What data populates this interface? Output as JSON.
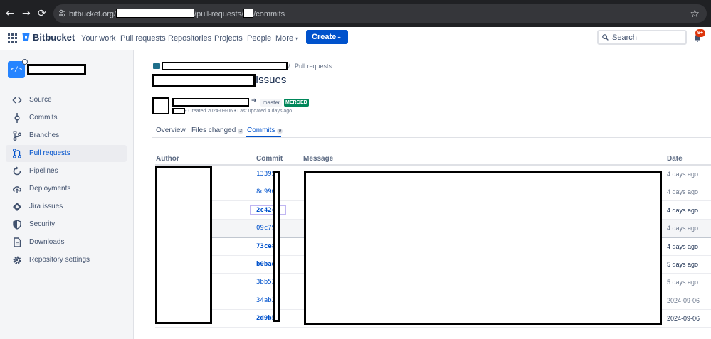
{
  "browser": {
    "url_host": "bitbucket.org/",
    "url_mid": "/pull-requests/",
    "url_tail": "/commits",
    "back_glyph": "←",
    "forward_glyph": "→",
    "reload_glyph": "⟳",
    "star_glyph": "☆"
  },
  "topnav": {
    "brand": "Bitbucket",
    "items": [
      "Your work",
      "Pull requests",
      "Repositories",
      "Projects",
      "People",
      "More"
    ],
    "more_chevron": "▾",
    "create_label": "Create",
    "create_chevron": "⌄",
    "search_placeholder": "Search",
    "notification_count": "9+",
    "accent": "#0052cc"
  },
  "sidebar": {
    "repo_avatar_glyph": "</>",
    "items": [
      {
        "label": "Source",
        "icon": "code-icon",
        "active": false
      },
      {
        "label": "Commits",
        "icon": "commit-icon",
        "active": false
      },
      {
        "label": "Branches",
        "icon": "branch-icon",
        "active": false
      },
      {
        "label": "Pull requests",
        "icon": "pull-request-icon",
        "active": true
      },
      {
        "label": "Pipelines",
        "icon": "pipelines-icon",
        "active": false
      },
      {
        "label": "Deployments",
        "icon": "cloud-upload-icon",
        "active": false
      },
      {
        "label": "Jira issues",
        "icon": "jira-icon",
        "active": false
      },
      {
        "label": "Security",
        "icon": "shield-icon",
        "active": false
      },
      {
        "label": "Downloads",
        "icon": "document-icon",
        "active": false
      },
      {
        "label": "Repository settings",
        "icon": "gear-icon",
        "active": false
      }
    ]
  },
  "main": {
    "breadcrumb_sep": "/",
    "breadcrumb_pr": "Pull requests",
    "title_suffix": "Issues",
    "destination_branch": "master",
    "arrow": "➔",
    "status": "MERGED",
    "meta": "• Created 2024-09-06 • Last updated 4 days ago",
    "tabs": [
      {
        "label": "Overview",
        "count": ""
      },
      {
        "label": "Files changed",
        "count": "2"
      },
      {
        "label": "Commits",
        "count": "9"
      }
    ],
    "columns": {
      "author": "Author",
      "commit": "Commit",
      "message": "Message",
      "date": "Date"
    },
    "commits": [
      {
        "hash": "13395",
        "date": "4 days ago",
        "emphasis": false
      },
      {
        "hash": "8c990",
        "date": "4 days ago",
        "emphasis": false
      },
      {
        "hash": "2c42c",
        "date": "4 days ago",
        "emphasis": true
      },
      {
        "hash": "09c79",
        "date": "4 days ago",
        "emphasis": false
      },
      {
        "hash": "73ce8",
        "date": "4 days ago",
        "emphasis": true
      },
      {
        "hash": "b0bad",
        "date": "5 days ago",
        "emphasis": true
      },
      {
        "hash": "3bb53",
        "date": "5 days ago",
        "emphasis": false
      },
      {
        "hash": "34ab2",
        "date": "2024-09-06",
        "emphasis": false
      },
      {
        "hash": "2d9b5",
        "date": "2024-09-06",
        "emphasis": true
      }
    ]
  }
}
